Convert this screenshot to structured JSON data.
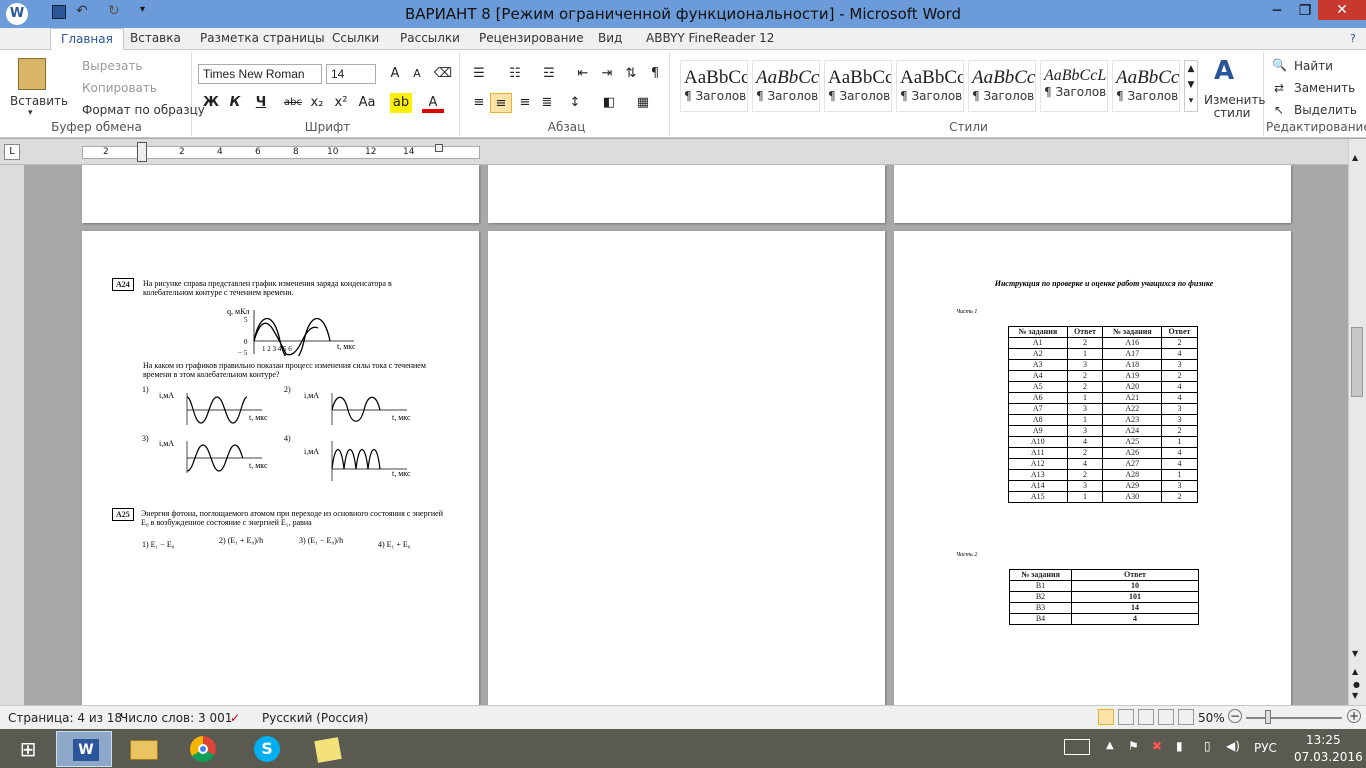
{
  "window": {
    "title": "ВАРИАНТ 8 [Режим ограниченной функциональности]  -  Microsoft Word",
    "min": "─",
    "max": "❐",
    "close": "✕"
  },
  "tabs": [
    "Главная",
    "Вставка",
    "Разметка страницы",
    "Ссылки",
    "Рассылки",
    "Рецензирование",
    "Вид",
    "ABBYY FineReader 12"
  ],
  "clipboard": {
    "paste": "Вставить",
    "cut": "Вырезать",
    "copy": "Копировать",
    "format": "Формат по образцу",
    "label": "Буфер обмена"
  },
  "font": {
    "name": "Times New Roman",
    "size": "14",
    "label": "Шрифт",
    "buttons": [
      "Ж",
      "К",
      "Ч",
      "abc",
      "x₂",
      "x²",
      "Aa"
    ]
  },
  "paragraph": {
    "label": "Абзац"
  },
  "styles": {
    "label": "Стили",
    "items": [
      {
        "sample": "AaBbCc",
        "name": "¶ Заголов..."
      },
      {
        "sample": "AaBbCcI",
        "name": "¶ Заголов..."
      },
      {
        "sample": "AaBbCcI",
        "name": "¶ Заголов..."
      },
      {
        "sample": "AaBbCc",
        "name": "¶ Заголов..."
      },
      {
        "sample": "AaBbCc",
        "name": "¶ Заголов..."
      },
      {
        "sample": "AaBbCcL",
        "name": "¶ Заголов..."
      },
      {
        "sample": "AaBbCc",
        "name": "¶ Заголов..."
      }
    ],
    "change": "Изменить стили"
  },
  "editing": {
    "label": "Редактирование",
    "find": "Найти",
    "replace": "Заменить",
    "select": "Выделить"
  },
  "ruler": {
    "ticks": [
      "2",
      "2",
      "4",
      "6",
      "8",
      "10",
      "12",
      "14"
    ]
  },
  "page1": {
    "a24": "A24",
    "a24_text": "На рисунке справа представлен график изменения заряда конденсатора в колебательном контуре с течением времени.",
    "graph_q": "q, мКл",
    "graph_t": "t, мкс",
    "question": "На каком из графиков правильно показан процесс изменения силы тока с течением времени в этом колебательном контуре?",
    "opt_labels": [
      "1)",
      "2)",
      "3)",
      "4)"
    ],
    "i_label": "i,мА",
    "a25": "A25",
    "a25_text": "Энергия фотона, поглощаемого атомом при переходе из основного состояния с энергией E₀ в возбужденное состояние с энергией E₁, равна",
    "a25_opts": [
      "1)  E₁ − E₀",
      "2)  (E₁ + E₀)/h",
      "3)  (E₁ − E₀)/h",
      "4)  E₁ + E₀"
    ]
  },
  "page3": {
    "title": "Инструкция по проверке и оценке работ учащихся по физике",
    "part1": "Часть 1",
    "part2": "Часть 2",
    "table1_headers": [
      "№ задания",
      "Ответ",
      "№ задания",
      "Ответ"
    ],
    "table1_rows": [
      [
        "A1",
        "2",
        "A16",
        "2"
      ],
      [
        "A2",
        "1",
        "A17",
        "4"
      ],
      [
        "A3",
        "3",
        "A18",
        "3"
      ],
      [
        "A4",
        "2",
        "A19",
        "2"
      ],
      [
        "A5",
        "2",
        "A20",
        "4"
      ],
      [
        "A6",
        "1",
        "A21",
        "4"
      ],
      [
        "A7",
        "3",
        "A22",
        "3"
      ],
      [
        "A8",
        "1",
        "A23",
        "3"
      ],
      [
        "A9",
        "3",
        "A24",
        "2"
      ],
      [
        "A10",
        "4",
        "A25",
        "1"
      ],
      [
        "A11",
        "2",
        "A26",
        "4"
      ],
      [
        "A12",
        "4",
        "A27",
        "4"
      ],
      [
        "A13",
        "2",
        "A28",
        "1"
      ],
      [
        "A14",
        "3",
        "A29",
        "3"
      ],
      [
        "A15",
        "1",
        "A30",
        "2"
      ]
    ],
    "table2_headers": [
      "№ задания",
      "Ответ"
    ],
    "table2_rows": [
      [
        "B1",
        "10"
      ],
      [
        "B2",
        "101"
      ],
      [
        "B3",
        "14"
      ],
      [
        "B4",
        "4"
      ]
    ]
  },
  "status": {
    "page": "Страница: 4 из 18",
    "words": "Число слов: 3 001",
    "lang": "Русский (Россия)",
    "zoom": "50%"
  },
  "tray": {
    "lang": "РУС",
    "time": "13:25",
    "date": "07.03.2016"
  }
}
